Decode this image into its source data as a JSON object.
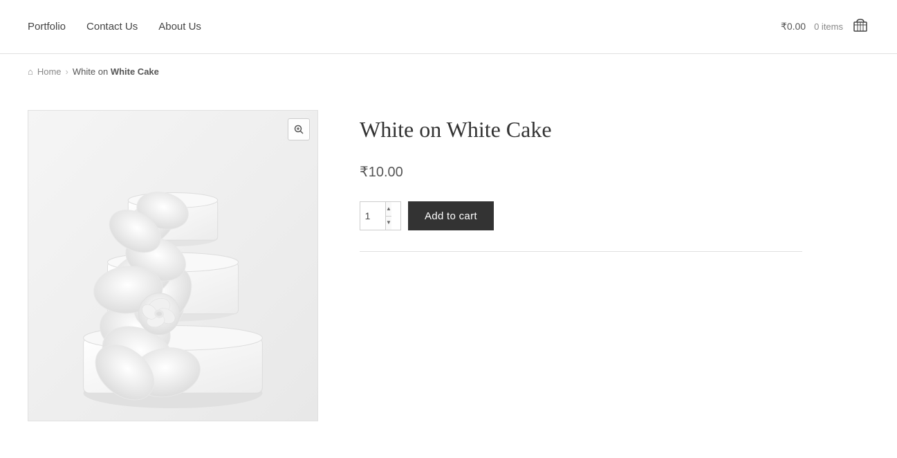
{
  "nav": {
    "portfolio_label": "Portfolio",
    "contact_label": "Contact Us",
    "about_label": "About Us"
  },
  "cart": {
    "price": "₹0.00",
    "items_count": "0 items"
  },
  "breadcrumb": {
    "home_label": "Home",
    "current_prefix": "White on ",
    "current_bold": "White Cake"
  },
  "product": {
    "title": "White on White Cake",
    "price": "₹10.00",
    "quantity_value": "1",
    "add_to_cart_label": "Add to cart"
  },
  "icons": {
    "zoom": "🔍",
    "home": "⌂",
    "cart": "🛒"
  }
}
